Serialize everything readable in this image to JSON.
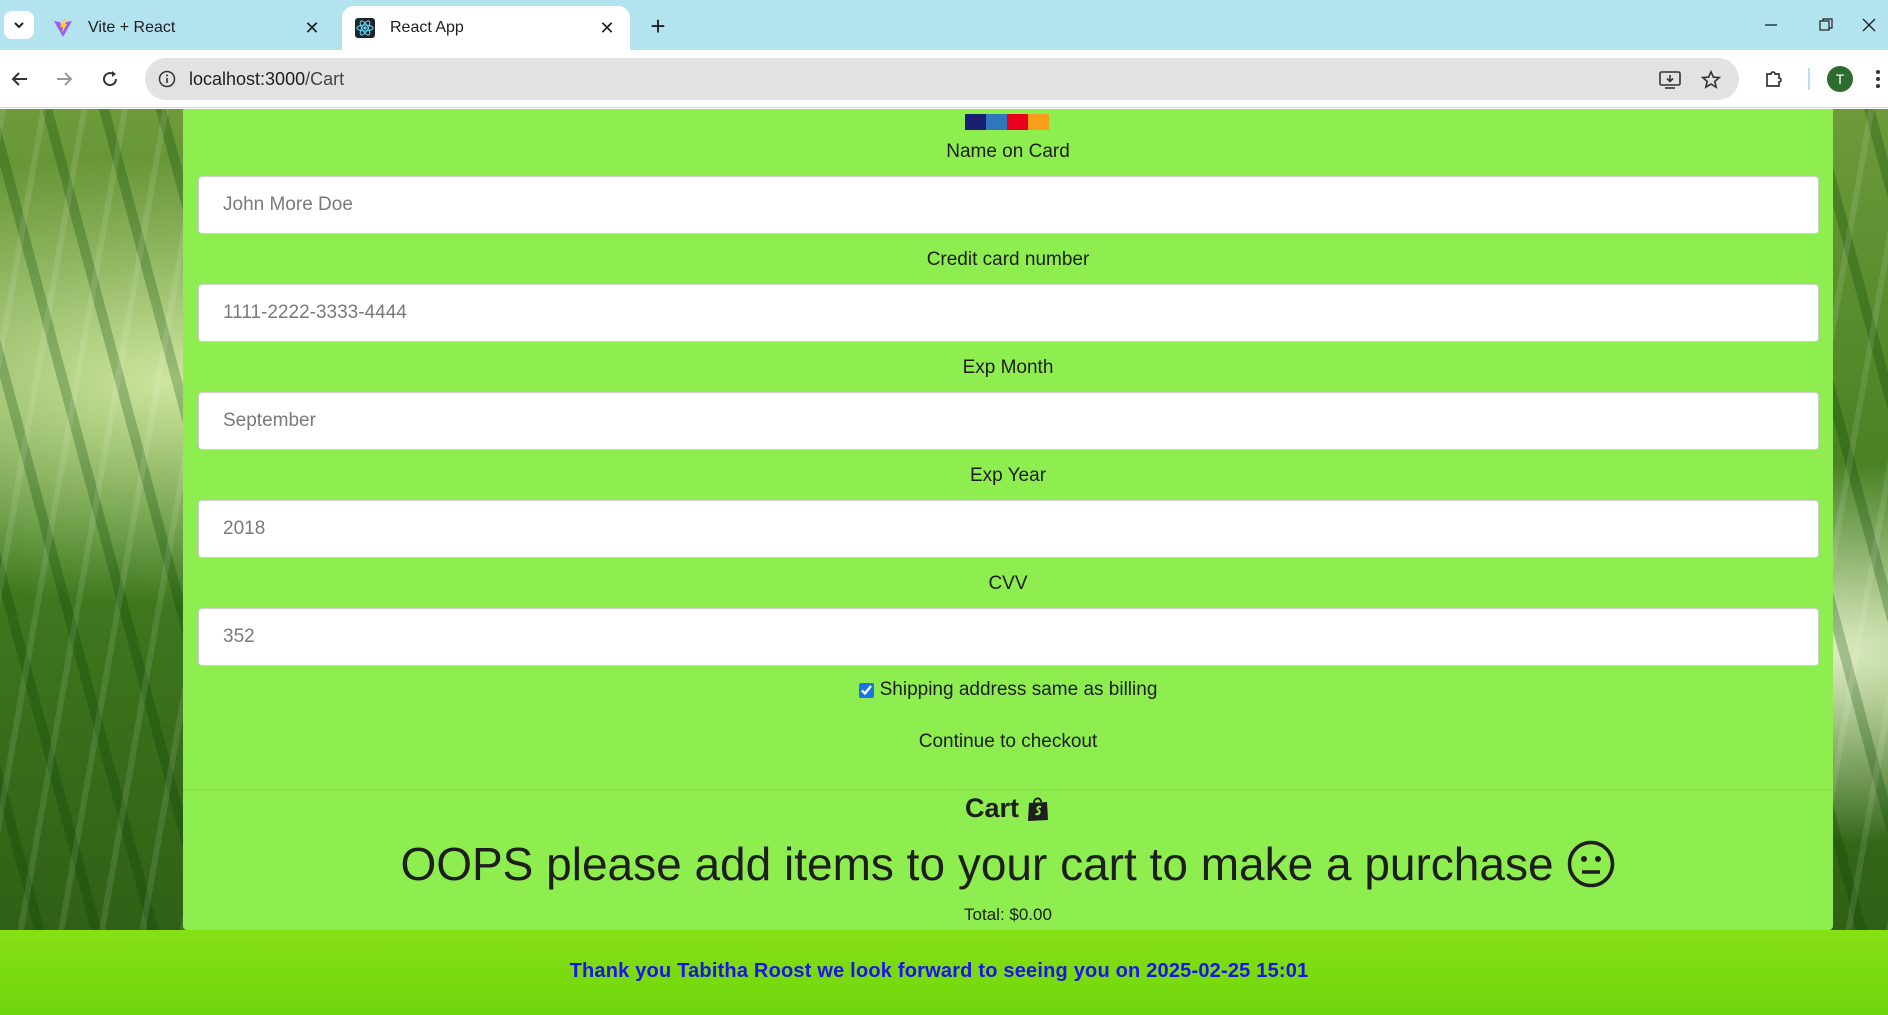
{
  "browser": {
    "tabs": [
      {
        "title": "Vite + React",
        "active": false
      },
      {
        "title": "React App",
        "active": true
      }
    ],
    "url_host": "localhost:3000",
    "url_path": "/Cart",
    "profile_initial": "T"
  },
  "payment": {
    "fields": [
      {
        "label": "Name on Card",
        "placeholder": "John More Doe"
      },
      {
        "label": "Credit card number",
        "placeholder": "1111-2222-3333-4444"
      },
      {
        "label": "Exp Month",
        "placeholder": "September"
      },
      {
        "label": "Exp Year",
        "placeholder": "2018"
      },
      {
        "label": "CVV",
        "placeholder": "352"
      }
    ],
    "shipping_checkbox_label": "Shipping address same as billing",
    "shipping_checked": true,
    "checkout_label": "Continue to checkout"
  },
  "cart": {
    "title": "Cart",
    "empty_message": "OOPS please add items to your cart to make a purchase",
    "total": "Total: $0.00"
  },
  "footer": {
    "message": "Thank you Tabitha Roost we look forward to seeing you on 2025-02-25 15:01"
  },
  "colors": {
    "card_bg": "#8eed4f",
    "footer_bg": "#7ddc12",
    "footer_text": "#1a14e8",
    "tabbar_bg": "#b3e3ef"
  },
  "icons": [
    "tab-list-icon",
    "vite-icon",
    "react-icon",
    "close-icon",
    "plus-icon",
    "minimize-icon",
    "restore-icon",
    "window-close-icon",
    "back-icon",
    "forward-icon",
    "reload-icon",
    "info-icon",
    "install-icon",
    "star-icon",
    "extensions-icon",
    "menu-icon",
    "credit-cards-icon",
    "shopify-bag-icon",
    "neutral-face-icon"
  ]
}
